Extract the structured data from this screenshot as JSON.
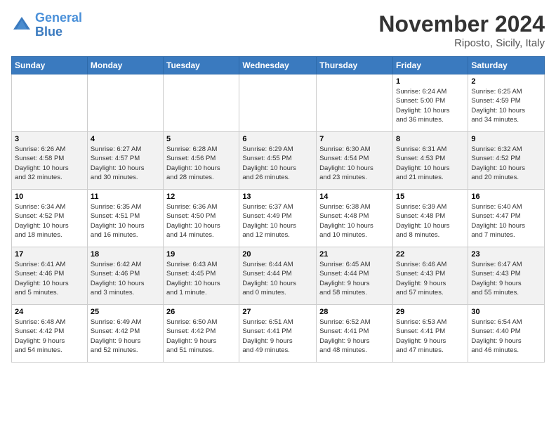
{
  "logo": {
    "line1": "General",
    "line2": "Blue"
  },
  "title": "November 2024",
  "location": "Riposto, Sicily, Italy",
  "days_of_week": [
    "Sunday",
    "Monday",
    "Tuesday",
    "Wednesday",
    "Thursday",
    "Friday",
    "Saturday"
  ],
  "weeks": [
    [
      {
        "num": "",
        "info": ""
      },
      {
        "num": "",
        "info": ""
      },
      {
        "num": "",
        "info": ""
      },
      {
        "num": "",
        "info": ""
      },
      {
        "num": "",
        "info": ""
      },
      {
        "num": "1",
        "info": "Sunrise: 6:24 AM\nSunset: 5:00 PM\nDaylight: 10 hours\nand 36 minutes."
      },
      {
        "num": "2",
        "info": "Sunrise: 6:25 AM\nSunset: 4:59 PM\nDaylight: 10 hours\nand 34 minutes."
      }
    ],
    [
      {
        "num": "3",
        "info": "Sunrise: 6:26 AM\nSunset: 4:58 PM\nDaylight: 10 hours\nand 32 minutes."
      },
      {
        "num": "4",
        "info": "Sunrise: 6:27 AM\nSunset: 4:57 PM\nDaylight: 10 hours\nand 30 minutes."
      },
      {
        "num": "5",
        "info": "Sunrise: 6:28 AM\nSunset: 4:56 PM\nDaylight: 10 hours\nand 28 minutes."
      },
      {
        "num": "6",
        "info": "Sunrise: 6:29 AM\nSunset: 4:55 PM\nDaylight: 10 hours\nand 26 minutes."
      },
      {
        "num": "7",
        "info": "Sunrise: 6:30 AM\nSunset: 4:54 PM\nDaylight: 10 hours\nand 23 minutes."
      },
      {
        "num": "8",
        "info": "Sunrise: 6:31 AM\nSunset: 4:53 PM\nDaylight: 10 hours\nand 21 minutes."
      },
      {
        "num": "9",
        "info": "Sunrise: 6:32 AM\nSunset: 4:52 PM\nDaylight: 10 hours\nand 20 minutes."
      }
    ],
    [
      {
        "num": "10",
        "info": "Sunrise: 6:34 AM\nSunset: 4:52 PM\nDaylight: 10 hours\nand 18 minutes."
      },
      {
        "num": "11",
        "info": "Sunrise: 6:35 AM\nSunset: 4:51 PM\nDaylight: 10 hours\nand 16 minutes."
      },
      {
        "num": "12",
        "info": "Sunrise: 6:36 AM\nSunset: 4:50 PM\nDaylight: 10 hours\nand 14 minutes."
      },
      {
        "num": "13",
        "info": "Sunrise: 6:37 AM\nSunset: 4:49 PM\nDaylight: 10 hours\nand 12 minutes."
      },
      {
        "num": "14",
        "info": "Sunrise: 6:38 AM\nSunset: 4:48 PM\nDaylight: 10 hours\nand 10 minutes."
      },
      {
        "num": "15",
        "info": "Sunrise: 6:39 AM\nSunset: 4:48 PM\nDaylight: 10 hours\nand 8 minutes."
      },
      {
        "num": "16",
        "info": "Sunrise: 6:40 AM\nSunset: 4:47 PM\nDaylight: 10 hours\nand 7 minutes."
      }
    ],
    [
      {
        "num": "17",
        "info": "Sunrise: 6:41 AM\nSunset: 4:46 PM\nDaylight: 10 hours\nand 5 minutes."
      },
      {
        "num": "18",
        "info": "Sunrise: 6:42 AM\nSunset: 4:46 PM\nDaylight: 10 hours\nand 3 minutes."
      },
      {
        "num": "19",
        "info": "Sunrise: 6:43 AM\nSunset: 4:45 PM\nDaylight: 10 hours\nand 1 minute."
      },
      {
        "num": "20",
        "info": "Sunrise: 6:44 AM\nSunset: 4:44 PM\nDaylight: 10 hours\nand 0 minutes."
      },
      {
        "num": "21",
        "info": "Sunrise: 6:45 AM\nSunset: 4:44 PM\nDaylight: 9 hours\nand 58 minutes."
      },
      {
        "num": "22",
        "info": "Sunrise: 6:46 AM\nSunset: 4:43 PM\nDaylight: 9 hours\nand 57 minutes."
      },
      {
        "num": "23",
        "info": "Sunrise: 6:47 AM\nSunset: 4:43 PM\nDaylight: 9 hours\nand 55 minutes."
      }
    ],
    [
      {
        "num": "24",
        "info": "Sunrise: 6:48 AM\nSunset: 4:42 PM\nDaylight: 9 hours\nand 54 minutes."
      },
      {
        "num": "25",
        "info": "Sunrise: 6:49 AM\nSunset: 4:42 PM\nDaylight: 9 hours\nand 52 minutes."
      },
      {
        "num": "26",
        "info": "Sunrise: 6:50 AM\nSunset: 4:42 PM\nDaylight: 9 hours\nand 51 minutes."
      },
      {
        "num": "27",
        "info": "Sunrise: 6:51 AM\nSunset: 4:41 PM\nDaylight: 9 hours\nand 49 minutes."
      },
      {
        "num": "28",
        "info": "Sunrise: 6:52 AM\nSunset: 4:41 PM\nDaylight: 9 hours\nand 48 minutes."
      },
      {
        "num": "29",
        "info": "Sunrise: 6:53 AM\nSunset: 4:41 PM\nDaylight: 9 hours\nand 47 minutes."
      },
      {
        "num": "30",
        "info": "Sunrise: 6:54 AM\nSunset: 4:40 PM\nDaylight: 9 hours\nand 46 minutes."
      }
    ]
  ]
}
